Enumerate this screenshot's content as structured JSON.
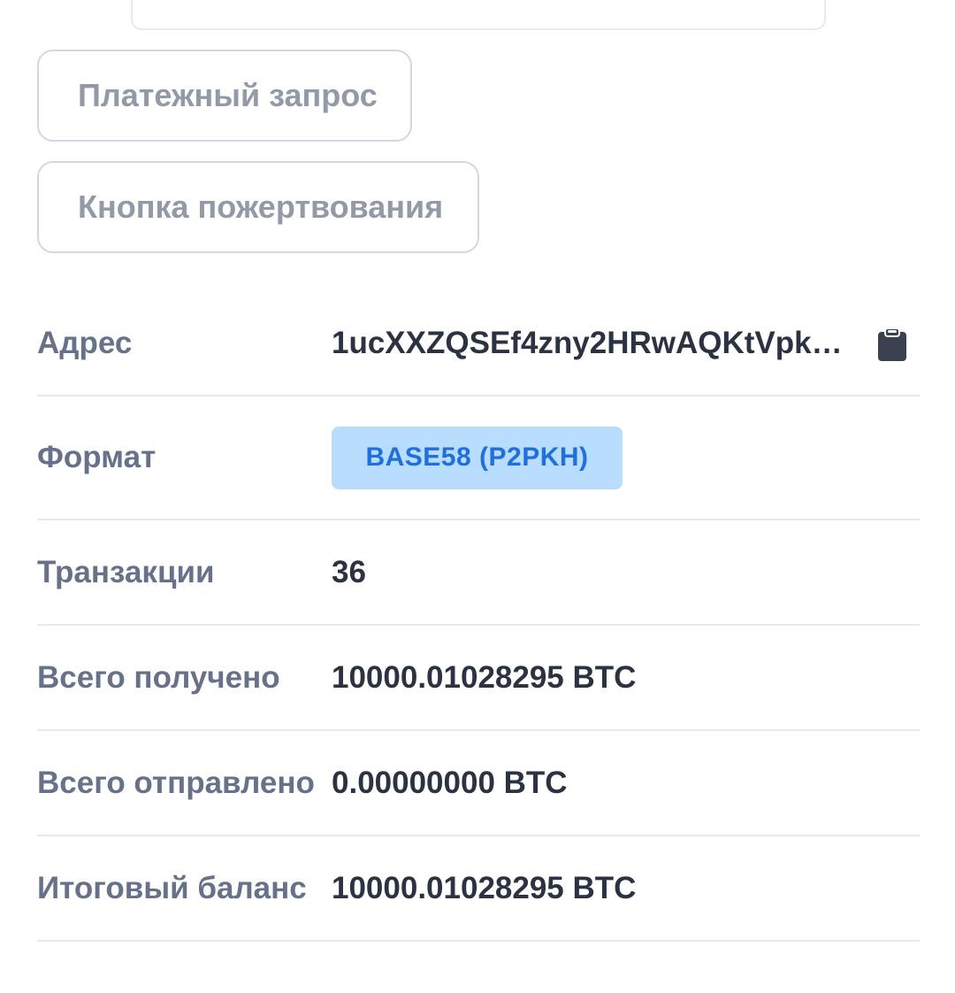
{
  "actions": {
    "payment_request_label": "Платежный запрос",
    "donation_button_label": "Кнопка пожертвования"
  },
  "details": {
    "address": {
      "label": "Адрес",
      "value": "1ucXXZQSEf4zny2HRwAQKtVpkL...",
      "copy_icon": "clipboard-icon"
    },
    "format": {
      "label": "Формат",
      "value": "BASE58 (P2PKH)",
      "badge_bg": "#b8dcfd",
      "badge_fg": "#1f6fdc"
    },
    "transactions": {
      "label": "Транзакции",
      "value": "36"
    },
    "total_received": {
      "label": "Всего получено",
      "value": "10000.01028295 BTC"
    },
    "total_sent": {
      "label": "Всего отправлено",
      "value": "0.00000000 BTC"
    },
    "final_balance": {
      "label": "Итоговый баланс",
      "value": "10000.01028295 BTC"
    }
  }
}
